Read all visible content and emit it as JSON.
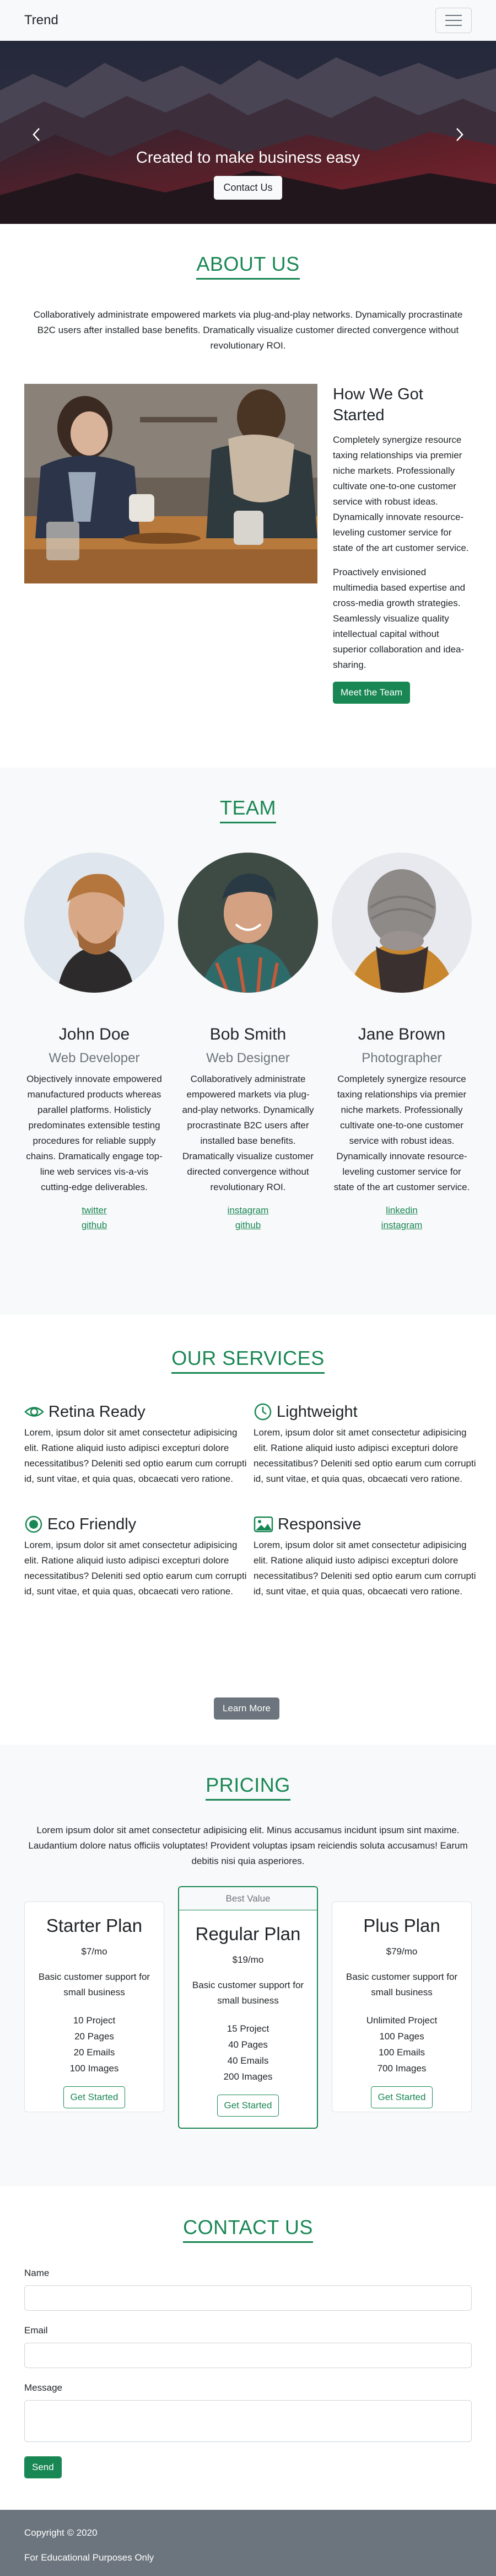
{
  "navbar": {
    "brand": "Trend",
    "menu_icon": "hamburger-icon"
  },
  "hero": {
    "caption": "Created to make business easy",
    "button": "Contact Us",
    "prev_icon": "chevron-left-icon",
    "next_icon": "chevron-right-icon"
  },
  "about": {
    "title": "ABOUT US",
    "lead": "Collaboratively administrate empowered markets via plug-and-play networks. Dynamically procrastinate B2C users after installed base benefits. Dramatically visualize customer directed convergence without revolutionary ROI.",
    "story_title": "How We Got Started",
    "story_p1": "Completely synergize resource taxing relationships via premier niche markets. Professionally cultivate one-to-one customer service with robust ideas. Dynamically innovate resource-leveling customer service for state of the art customer service.",
    "story_p2": "Proactively envisioned multimedia based expertise and cross-media growth strategies. Seamlessly visualize quality intellectual capital without superior collaboration and idea-sharing.",
    "button": "Meet the Team"
  },
  "team": {
    "title": "TEAM",
    "members": [
      {
        "name": "John Doe",
        "role": "Web Developer",
        "bio": "Objectively innovate empowered manufactured products whereas parallel platforms. Holisticly predominates extensible testing procedures for reliable supply chains. Dramatically engage top-line web services vis-a-vis cutting-edge deliverables.",
        "links": [
          "twitter",
          "github"
        ]
      },
      {
        "name": "Bob Smith",
        "role": "Web Designer",
        "bio": "Collaboratively administrate empowered markets via plug-and-play networks. Dynamically procrastinate B2C users after installed base benefits. Dramatically visualize customer directed convergence without revolutionary ROI.",
        "links": [
          "instagram",
          "github"
        ]
      },
      {
        "name": "Jane Brown",
        "role": "Photographer",
        "bio": "Completely synergize resource taxing relationships via premier niche markets. Professionally cultivate one-to-one customer service with robust ideas. Dynamically innovate resource-leveling customer service for state of the art customer service.",
        "links": [
          "linkedin",
          "instagram"
        ]
      }
    ]
  },
  "services": {
    "title": "OUR SERVICES",
    "items": [
      {
        "title": "Retina Ready",
        "icon": "eye-icon",
        "text": "Lorem, ipsum dolor sit amet consectetur adipisicing elit. Ratione aliquid iusto adipisci excepturi dolore necessitatibus? Deleniti sed optio earum cum corrupti id, sunt vitae, et quia quas, obcaecati vero ratione."
      },
      {
        "title": "Lightweight",
        "icon": "clock-icon",
        "text": "Lorem, ipsum dolor sit amet consectetur adipisicing elit. Ratione aliquid iusto adipisci excepturi dolore necessitatibus? Deleniti sed optio earum cum corrupti id, sunt vitae, et quia quas, obcaecati vero ratione."
      },
      {
        "title": "Eco Friendly",
        "icon": "record-circle-icon",
        "text": "Lorem, ipsum dolor sit amet consectetur adipisicing elit. Ratione aliquid iusto adipisci excepturi dolore necessitatibus? Deleniti sed optio earum cum corrupti id, sunt vitae, et quia quas, obcaecati vero ratione."
      },
      {
        "title": "Responsive",
        "icon": "image-icon",
        "text": "Lorem, ipsum dolor sit amet consectetur adipisicing elit. Ratione aliquid iusto adipisci excepturi dolore necessitatibus? Deleniti sed optio earum cum corrupti id, sunt vitae, et quia quas, obcaecati vero ratione."
      }
    ],
    "button": "Learn More"
  },
  "pricing": {
    "title": "PRICING",
    "lead": "Lorem ipsum dolor sit amet consectetur adipisicing elit. Minus accusamus incidunt ipsum sint maxime. Laudantium dolore natus officiis voluptates! Provident voluptas ipsam reiciendis soluta accusamus! Earum debitis nisi quia asperiores.",
    "best_value": "Best Value",
    "plans": [
      {
        "name": "Starter Plan",
        "price": "$7/mo",
        "desc": "Basic customer support for small business",
        "features": [
          "10 Project",
          "20 Pages",
          "20 Emails",
          "100 Images"
        ],
        "button": "Get Started"
      },
      {
        "name": "Regular Plan",
        "price": "$19/mo",
        "desc": "Basic customer support for small business",
        "features": [
          "15 Project",
          "40 Pages",
          "40 Emails",
          "200 Images"
        ],
        "button": "Get Started"
      },
      {
        "name": "Plus Plan",
        "price": "$79/mo",
        "desc": "Basic customer support for small business",
        "features": [
          "Unlimited Project",
          "100 Pages",
          "100 Emails",
          "700 Images"
        ],
        "button": "Get Started"
      }
    ]
  },
  "contact": {
    "title": "CONTACT US",
    "name_label": "Name",
    "email_label": "Email",
    "message_label": "Message",
    "name_value": "",
    "email_value": "",
    "message_value": "",
    "button": "Send"
  },
  "footer": {
    "copyright": "Copyright © 2020",
    "note": "For Educational Purposes Only"
  },
  "colors": {
    "accent": "#198754",
    "secondary": "#6c757d",
    "light": "#f8f9fa"
  }
}
